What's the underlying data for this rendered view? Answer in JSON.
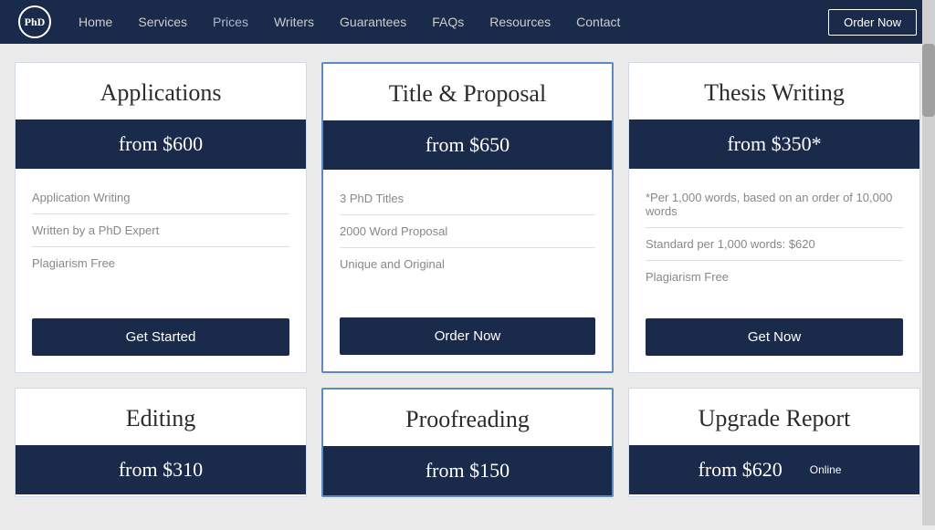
{
  "nav": {
    "logo_text": "PhD",
    "links": [
      {
        "label": "Home",
        "active": false
      },
      {
        "label": "Services",
        "active": false
      },
      {
        "label": "Prices",
        "active": true
      },
      {
        "label": "Writers",
        "active": false
      },
      {
        "label": "Guarantees",
        "active": false
      },
      {
        "label": "FAQs",
        "active": false
      },
      {
        "label": "Resources",
        "active": false
      },
      {
        "label": "Contact",
        "active": false
      }
    ],
    "order_button": "Order Now"
  },
  "cards_row1": [
    {
      "id": "applications",
      "title": "Applications",
      "price": "from $600",
      "highlighted": false,
      "features": [
        "Application Writing",
        "Written by a PhD Expert",
        "Plagiarism Free"
      ],
      "button": "Get Started"
    },
    {
      "id": "title-proposal",
      "title": "Title & Proposal",
      "price": "from $650",
      "highlighted": true,
      "features": [
        "3 PhD Titles",
        "2000 Word Proposal",
        "Unique and Original"
      ],
      "button": "Order Now"
    },
    {
      "id": "thesis-writing",
      "title": "Thesis Writing",
      "price": "from $350*",
      "highlighted": false,
      "features": [
        "*Per 1,000 words, based on an order of 10,000 words",
        "Standard per 1,000 words: $620",
        "Plagiarism Free"
      ],
      "button": "Get Now"
    }
  ],
  "cards_row2": [
    {
      "id": "editing",
      "title": "Editing",
      "price": "from $310",
      "highlighted": false,
      "features": [],
      "button": null
    },
    {
      "id": "proofreading",
      "title": "Proofreading",
      "price": "from $150",
      "highlighted": true,
      "features": [],
      "button": null
    },
    {
      "id": "upgrade-report",
      "title": "Upgrade Report",
      "price": "from $620",
      "highlighted": false,
      "features": [],
      "button": null,
      "badge": "Online"
    }
  ]
}
